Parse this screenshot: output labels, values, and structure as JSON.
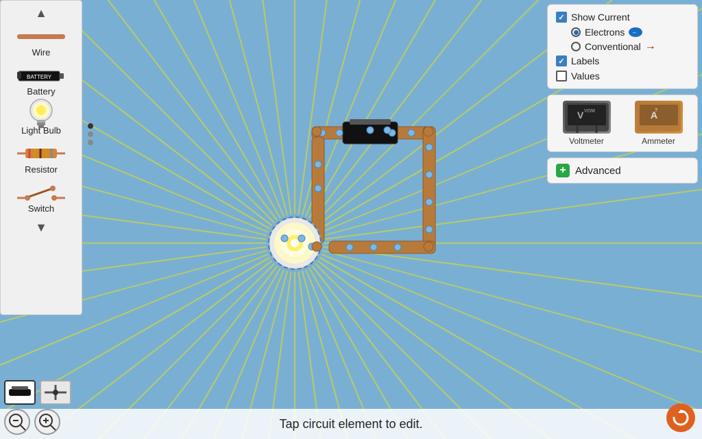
{
  "sidebar": {
    "items": [
      {
        "label": "Wire",
        "icon": "wire-icon"
      },
      {
        "label": "Battery",
        "icon": "battery-icon"
      },
      {
        "label": "Light Bulb",
        "icon": "lightbulb-icon"
      },
      {
        "label": "Resistor",
        "icon": "resistor-icon"
      },
      {
        "label": "Switch",
        "icon": "switch-icon"
      }
    ],
    "arrow_up": "▲",
    "arrow_down": "▼"
  },
  "options": {
    "show_current_label": "Show Current",
    "show_current_checked": true,
    "electrons_label": "Electrons",
    "electrons_selected": true,
    "conventional_label": "Conventional",
    "conventional_selected": false,
    "labels_label": "Labels",
    "labels_checked": true,
    "values_label": "Values",
    "values_checked": false
  },
  "meters": [
    {
      "label": "Voltmeter",
      "type": "voltmeter"
    },
    {
      "label": "Ammeter",
      "type": "ammeter"
    }
  ],
  "advanced": {
    "label": "Advanced",
    "plus": "+"
  },
  "toolbar": {
    "wire_tool_label": "wire-tool",
    "junction_tool_label": "junction-tool"
  },
  "status": {
    "text": "Tap circuit element to edit."
  },
  "zoom": {
    "out_label": "−",
    "in_label": "+"
  },
  "refresh": {
    "icon": "↺"
  }
}
